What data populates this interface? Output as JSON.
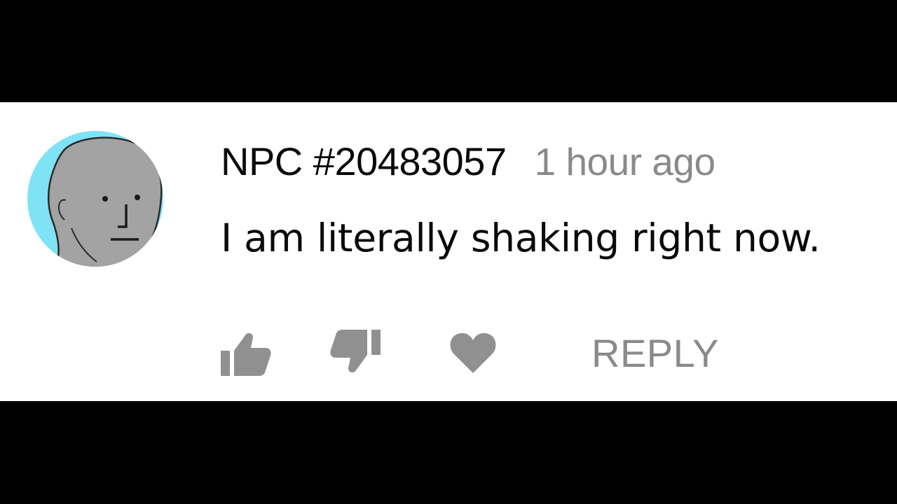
{
  "comment": {
    "author": "NPC #20483057",
    "timestamp": "1 hour ago",
    "text": "I am literally shaking right now."
  },
  "actions": {
    "like_icon": "thumbs-up-icon",
    "dislike_icon": "thumbs-down-icon",
    "heart_icon": "heart-icon",
    "reply_label": "REPLY"
  },
  "colors": {
    "background": "#ffffff",
    "letterbox": "#000000",
    "author_text": "#0a0a0a",
    "meta_text": "#8a8a8a",
    "icon_gray": "#909090",
    "avatar_bg": "#7fe3f5",
    "avatar_face": "#a3a3a3"
  }
}
